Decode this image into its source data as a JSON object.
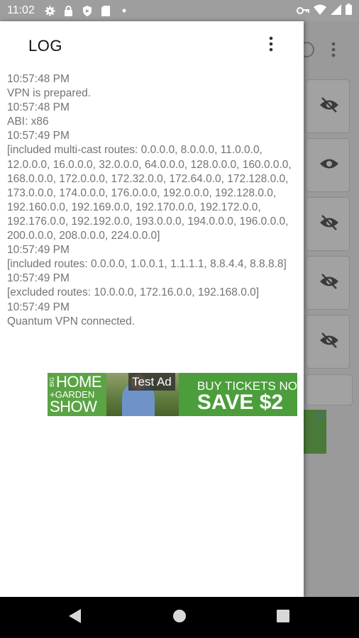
{
  "status_bar": {
    "time": "11:02",
    "left_icons": [
      "gear-icon",
      "lock-icon",
      "shield-icon",
      "sd-card-icon",
      "dot-icon"
    ],
    "right_icons": [
      "key-icon",
      "wifi-icon",
      "signal-icon",
      "battery-icon"
    ]
  },
  "drawer": {
    "title": "LOG",
    "menu_icon": "more-vertical-icon",
    "log_lines": [
      "10:57:48 PM",
      "VPN is prepared.",
      "10:57:48 PM",
      "ABI: x86",
      "10:57:49 PM",
      "[included multi-cast routes: 0.0.0.0, 8.0.0.0, 11.0.0.0, 12.0.0.0, 16.0.0.0, 32.0.0.0, 64.0.0.0, 128.0.0.0, 160.0.0.0, 168.0.0.0, 172.0.0.0, 172.32.0.0, 172.64.0.0, 172.128.0.0, 173.0.0.0, 174.0.0.0, 176.0.0.0, 192.0.0.0, 192.128.0.0, 192.160.0.0, 192.169.0.0, 192.170.0.0, 192.172.0.0, 192.176.0.0, 192.192.0.0, 193.0.0.0, 194.0.0.0, 196.0.0.0, 200.0.0.0, 208.0.0.0, 224.0.0.0]",
      "10:57:49 PM",
      "[included routes: 0.0.0.0, 1.0.0.1, 1.1.1.1, 8.8.4.4, 8.8.8.8]",
      "10:57:49 PM",
      "[excluded routes: 10.0.0.0, 172.16.0.0, 192.168.0.0]",
      "10:57:49 PM",
      "Quantum VPN connected."
    ]
  },
  "ad": {
    "left_big_1": "HOME",
    "left_small": "+GARDEN",
    "left_big_2": "SHOW",
    "left_tag": "BIG",
    "test_label": "Test Ad",
    "right_line_1": "BUY TICKETS NO",
    "right_line_2": "SAVE $2"
  },
  "background_app": {
    "card_icons": [
      "eye-off-icon",
      "eye-icon",
      "eye-off-icon",
      "eye-off-icon",
      "eye-off-icon"
    ]
  },
  "nav_bar": {
    "icons": [
      "back-icon",
      "home-icon",
      "recents-icon"
    ]
  }
}
